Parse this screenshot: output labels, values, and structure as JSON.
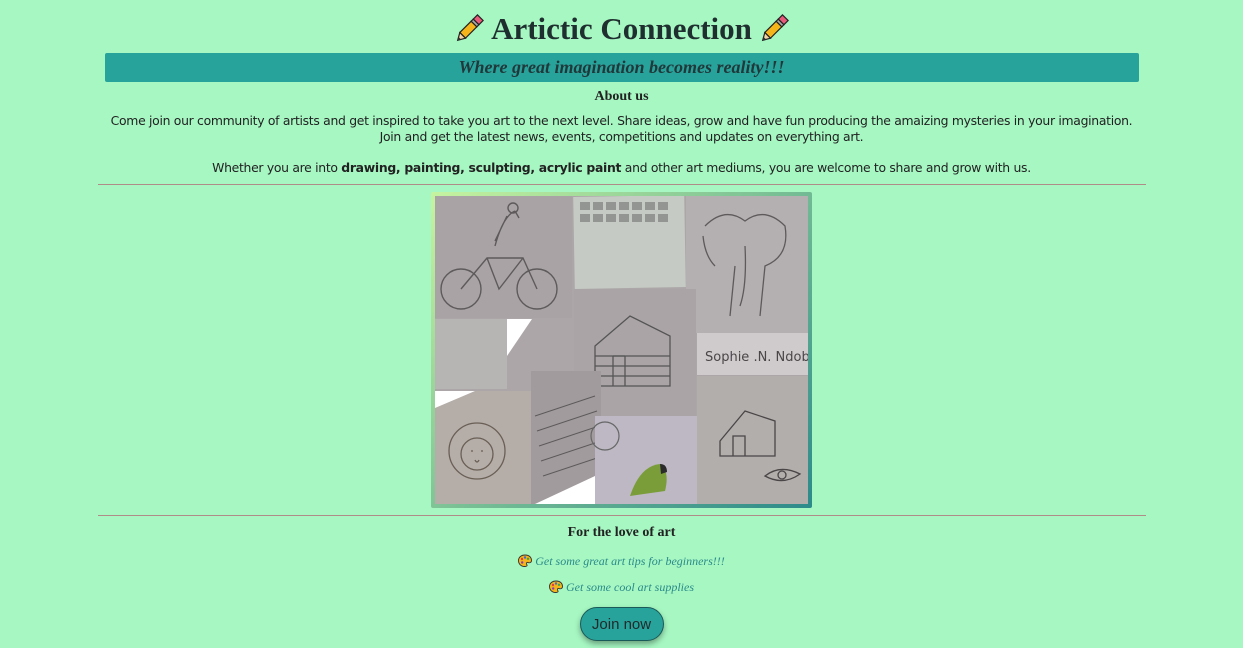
{
  "header": {
    "title": "Artictic Connection",
    "tagline": "Where great imagination becomes reality!!!"
  },
  "about": {
    "heading": "About us",
    "paragraph1": "Come join our community of artists and get inspired to take you art to the next level. Share ideas, grow and have fun producing the amaizing mysteries in your imagination. Join and get the latest news, events, competitions and updates on everything art.",
    "paragraph2_prefix": "Whether you are into ",
    "paragraph2_bold": "drawing, painting, sculpting, acrylic paint",
    "paragraph2_suffix": " and other art mediums, you are welcome to share and grow with us."
  },
  "collage": {
    "signature": "Sophie .N. Ndobe"
  },
  "love": {
    "heading": "For the love of art",
    "link1": "Get some great art tips for beginners!!!",
    "link2": "Get some cool art supplies"
  },
  "cta": {
    "join_label": "Join now"
  },
  "colors": {
    "background": "#a6f7c2",
    "banner": "#28a39c",
    "link": "#2c8a8a"
  },
  "icons": [
    "pencil-icon",
    "artist-palette-icon"
  ]
}
